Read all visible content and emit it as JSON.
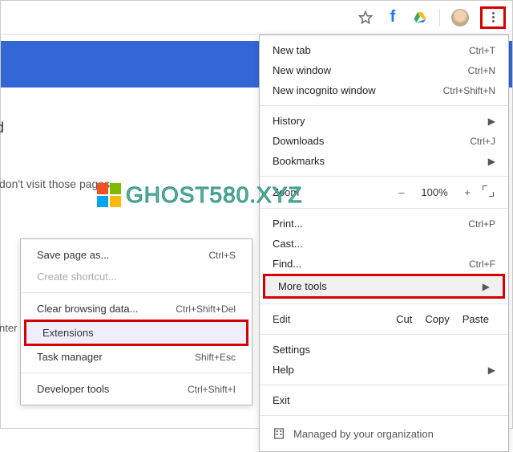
{
  "toolbar": {
    "star": "star-icon",
    "fb": "f",
    "drive": "drive-icon",
    "avatar": "avatar",
    "kebab": "more-icon"
  },
  "partial": {
    "d": "d",
    "visit": "don't visit those pages",
    "enter": "nter"
  },
  "watermark": "GHOST580.XYZ",
  "main_menu": {
    "new_tab": {
      "label": "New tab",
      "shortcut": "Ctrl+T"
    },
    "new_window": {
      "label": "New window",
      "shortcut": "Ctrl+N"
    },
    "incognito": {
      "label": "New incognito window",
      "shortcut": "Ctrl+Shift+N"
    },
    "history": {
      "label": "History"
    },
    "downloads": {
      "label": "Downloads",
      "shortcut": "Ctrl+J"
    },
    "bookmarks": {
      "label": "Bookmarks"
    },
    "zoom": {
      "label": "Zoom",
      "minus": "–",
      "pct": "100%",
      "plus": "+"
    },
    "print": {
      "label": "Print...",
      "shortcut": "Ctrl+P"
    },
    "cast": {
      "label": "Cast..."
    },
    "find": {
      "label": "Find...",
      "shortcut": "Ctrl+F"
    },
    "more_tools": {
      "label": "More tools"
    },
    "edit": {
      "label": "Edit",
      "cut": "Cut",
      "copy": "Copy",
      "paste": "Paste"
    },
    "settings": {
      "label": "Settings"
    },
    "help": {
      "label": "Help"
    },
    "exit": {
      "label": "Exit"
    },
    "managed": {
      "label": "Managed by your organization"
    }
  },
  "sub_menu": {
    "save_page": {
      "label": "Save page as...",
      "shortcut": "Ctrl+S"
    },
    "create_shortcut": {
      "label": "Create shortcut..."
    },
    "clear_browsing": {
      "label": "Clear browsing data...",
      "shortcut": "Ctrl+Shift+Del"
    },
    "extensions": {
      "label": "Extensions"
    },
    "task_manager": {
      "label": "Task manager",
      "shortcut": "Shift+Esc"
    },
    "dev_tools": {
      "label": "Developer tools",
      "shortcut": "Ctrl+Shift+I"
    }
  }
}
